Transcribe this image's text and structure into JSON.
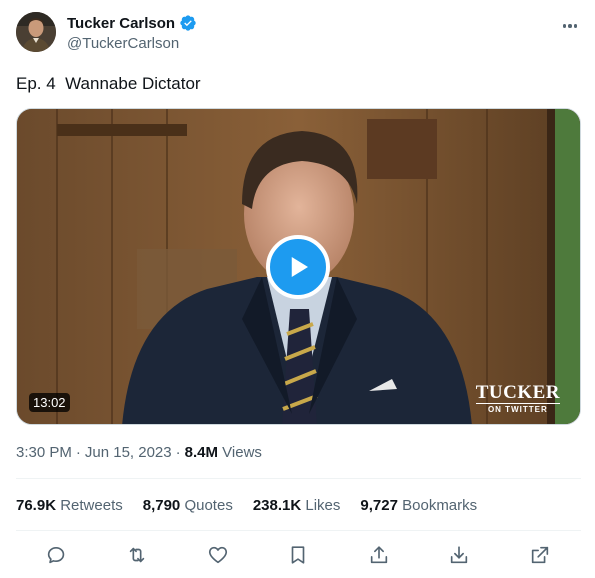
{
  "author": {
    "display_name": "Tucker Carlson",
    "handle": "@TuckerCarlson",
    "verified": true,
    "avatar_icon": "profile-photo"
  },
  "tweet": {
    "text": "Ep. 4  Wannabe Dictator"
  },
  "media": {
    "type": "video",
    "duration": "13:02",
    "watermark_main": "TUCKER",
    "watermark_sub": "ON TWITTER",
    "play_icon": "play-icon"
  },
  "meta": {
    "time": "3:30 PM",
    "separator": "·",
    "date": "Jun 15, 2023",
    "views_count": "8.4M",
    "views_label": "Views"
  },
  "stats": [
    {
      "count": "76.9K",
      "label": "Retweets"
    },
    {
      "count": "8,790",
      "label": "Quotes"
    },
    {
      "count": "238.1K",
      "label": "Likes"
    },
    {
      "count": "9,727",
      "label": "Bookmarks"
    }
  ],
  "actions": [
    "reply-icon",
    "retweet-icon",
    "like-icon",
    "bookmark-icon",
    "share-icon",
    "download-icon",
    "open-external-icon"
  ],
  "colors": {
    "accent": "#1d9bf0",
    "text_primary": "#0f1419",
    "text_secondary": "#536471",
    "divider": "#eff3f4"
  }
}
